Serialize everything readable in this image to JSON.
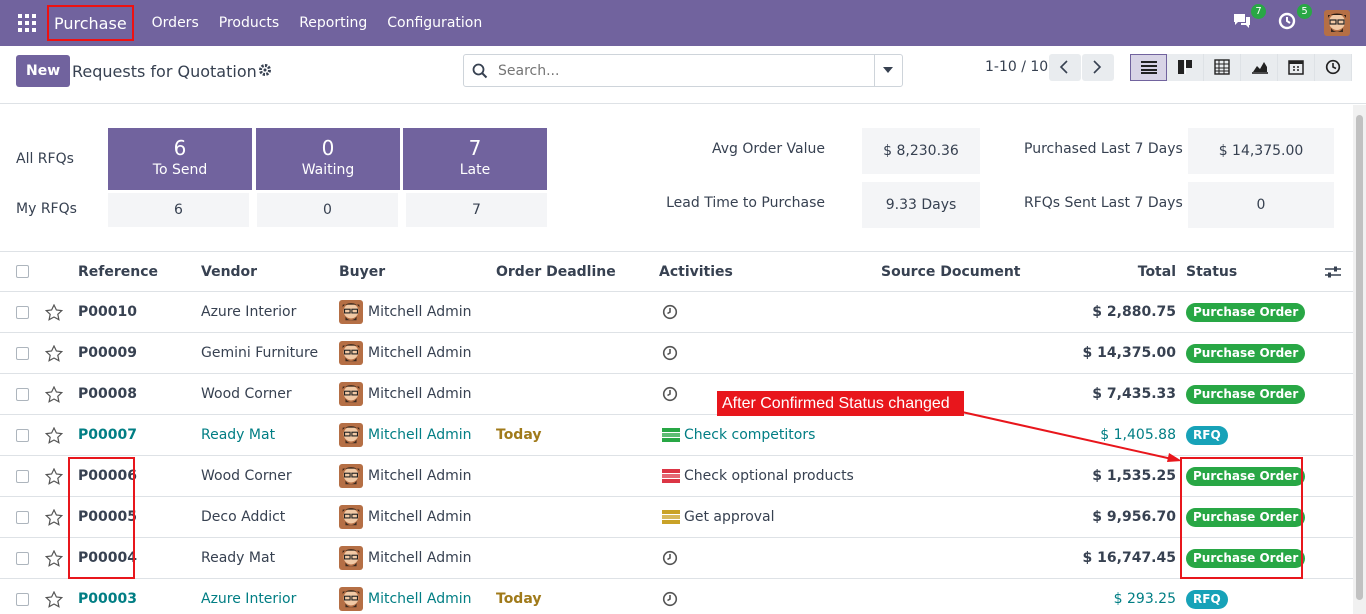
{
  "nav": {
    "app_name": "Purchase",
    "menu": [
      "Orders",
      "Products",
      "Reporting",
      "Configuration"
    ],
    "messages_count": "7",
    "activities_count": "5"
  },
  "control": {
    "new_label": "New",
    "title": "Requests for Quotation",
    "search_placeholder": "Search...",
    "pager": "1-10 / 10"
  },
  "dashboard": {
    "all_rfqs_label": "All RFQs",
    "my_rfqs_label": "My RFQs",
    "tiles": [
      {
        "num": "6",
        "label": "To Send",
        "mine": "6"
      },
      {
        "num": "0",
        "label": "Waiting",
        "mine": "0"
      },
      {
        "num": "7",
        "label": "Late",
        "mine": "7"
      }
    ],
    "kpis": {
      "avg_order_label": "Avg Order Value",
      "avg_order_value": "$ 8,230.36",
      "purchased_label": "Purchased Last 7 Days",
      "purchased_value": "$ 14,375.00",
      "lead_time_label": "Lead Time to Purchase",
      "lead_time_value": "9.33 Days",
      "rfqs_sent_label": "RFQs Sent Last 7 Days",
      "rfqs_sent_value": "0"
    }
  },
  "table": {
    "headers": {
      "reference": "Reference",
      "vendor": "Vendor",
      "buyer": "Buyer",
      "deadline": "Order Deadline",
      "activities": "Activities",
      "source": "Source Document",
      "total": "Total",
      "status": "Status"
    },
    "rows": [
      {
        "ref": "P00010",
        "vendor": "Azure Interior",
        "buyer": "Mitchell Admin",
        "deadline": "",
        "activity": "",
        "total": "$ 2,880.75",
        "status": "Purchase Order"
      },
      {
        "ref": "P00009",
        "vendor": "Gemini Furniture",
        "buyer": "Mitchell Admin",
        "deadline": "",
        "activity": "",
        "total": "$ 14,375.00",
        "status": "Purchase Order"
      },
      {
        "ref": "P00008",
        "vendor": "Wood Corner",
        "buyer": "Mitchell Admin",
        "deadline": "",
        "activity": "",
        "total": "$ 7,435.33",
        "status": "Purchase Order"
      },
      {
        "ref": "P00007",
        "vendor": "Ready Mat",
        "buyer": "Mitchell Admin",
        "deadline": "Today",
        "activity": "Check competitors",
        "total": "$ 1,405.88",
        "status": "RFQ"
      },
      {
        "ref": "P00006",
        "vendor": "Wood Corner",
        "buyer": "Mitchell Admin",
        "deadline": "",
        "activity": "Check optional products",
        "total": "$ 1,535.25",
        "status": "Purchase Order"
      },
      {
        "ref": "P00005",
        "vendor": "Deco Addict",
        "buyer": "Mitchell Admin",
        "deadline": "",
        "activity": "Get approval",
        "total": "$ 9,956.70",
        "status": "Purchase Order"
      },
      {
        "ref": "P00004",
        "vendor": "Ready Mat",
        "buyer": "Mitchell Admin",
        "deadline": "",
        "activity": "",
        "total": "$ 16,747.45",
        "status": "Purchase Order"
      },
      {
        "ref": "P00003",
        "vendor": "Azure Interior",
        "buyer": "Mitchell Admin",
        "deadline": "Today",
        "activity": "",
        "total": "$ 293.25",
        "status": "RFQ"
      }
    ]
  },
  "annotation": {
    "text": "After Confirmed Status changed"
  },
  "colors": {
    "brand": "#71639e",
    "status_po": "#28a745",
    "status_rfq": "#17a2b8",
    "annotation": "#e8161c"
  }
}
